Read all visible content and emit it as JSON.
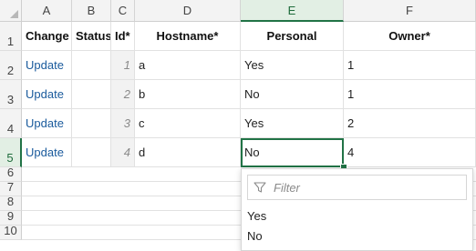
{
  "columns": [
    "A",
    "B",
    "C",
    "D",
    "E",
    "F"
  ],
  "rows": [
    "1",
    "2",
    "3",
    "4",
    "5",
    "6",
    "7",
    "8",
    "9",
    "10"
  ],
  "headers": {
    "change": "Change",
    "status": "Status",
    "id": "Id*",
    "hostname": "Hostname*",
    "personal": "Personal",
    "owner": "Owner*"
  },
  "data": [
    {
      "change": "Update",
      "status": "",
      "id": "1",
      "hostname": "a",
      "personal": "Yes",
      "owner": "1"
    },
    {
      "change": "Update",
      "status": "",
      "id": "2",
      "hostname": "b",
      "personal": "No",
      "owner": "1"
    },
    {
      "change": "Update",
      "status": "",
      "id": "3",
      "hostname": "c",
      "personal": "Yes",
      "owner": "2"
    },
    {
      "change": "Update",
      "status": "",
      "id": "4",
      "hostname": "d",
      "personal": "No",
      "owner": "4"
    }
  ],
  "dropdown": {
    "filter_placeholder": "Filter",
    "options": [
      "Yes",
      "No"
    ]
  },
  "colors": {
    "accent": "#217346",
    "link": "#1a5a9c"
  }
}
